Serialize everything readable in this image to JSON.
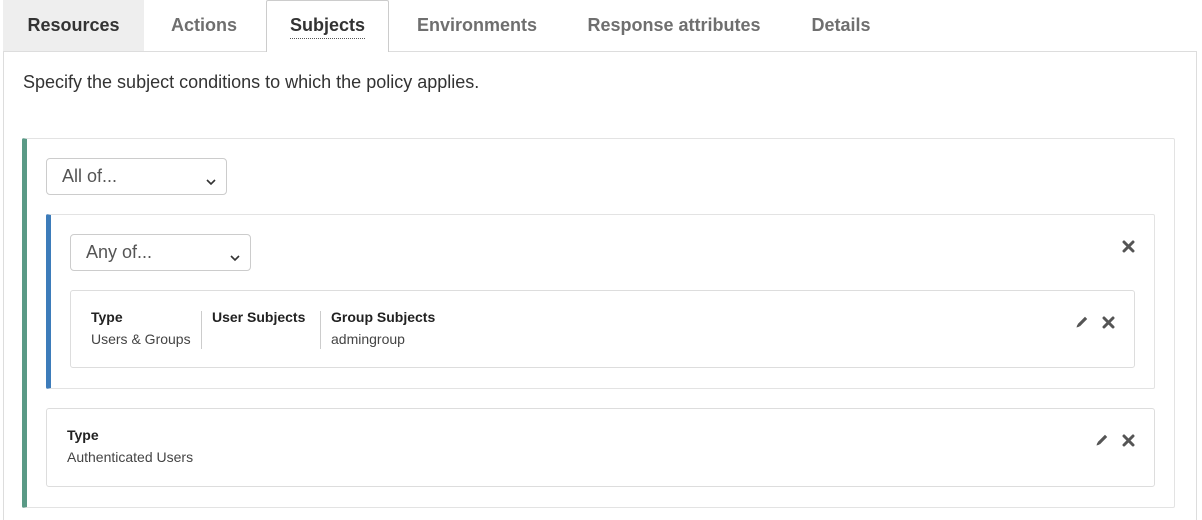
{
  "tabs": [
    {
      "label": "Resources"
    },
    {
      "label": "Actions"
    },
    {
      "label": "Subjects"
    },
    {
      "label": "Environments"
    },
    {
      "label": "Response attributes"
    },
    {
      "label": "Details"
    }
  ],
  "intro_text": "Specify the subject conditions to which the policy applies.",
  "outer_group": {
    "operator": "All of...",
    "inner_group": {
      "operator": "Any of...",
      "condition": {
        "type_label": "Type",
        "type_value": "Users & Groups",
        "user_subjects_label": "User Subjects",
        "user_subjects_value": "",
        "group_subjects_label": "Group Subjects",
        "group_subjects_value": "admingroup"
      }
    },
    "condition": {
      "type_label": "Type",
      "type_value": "Authenticated Users"
    }
  },
  "colors": {
    "outer_accent": "#5a9a86",
    "inner_accent": "#3d7cba"
  },
  "icons": {
    "edit": "pencil-icon",
    "delete": "close-icon",
    "dropdown": "chevron-down-icon"
  }
}
